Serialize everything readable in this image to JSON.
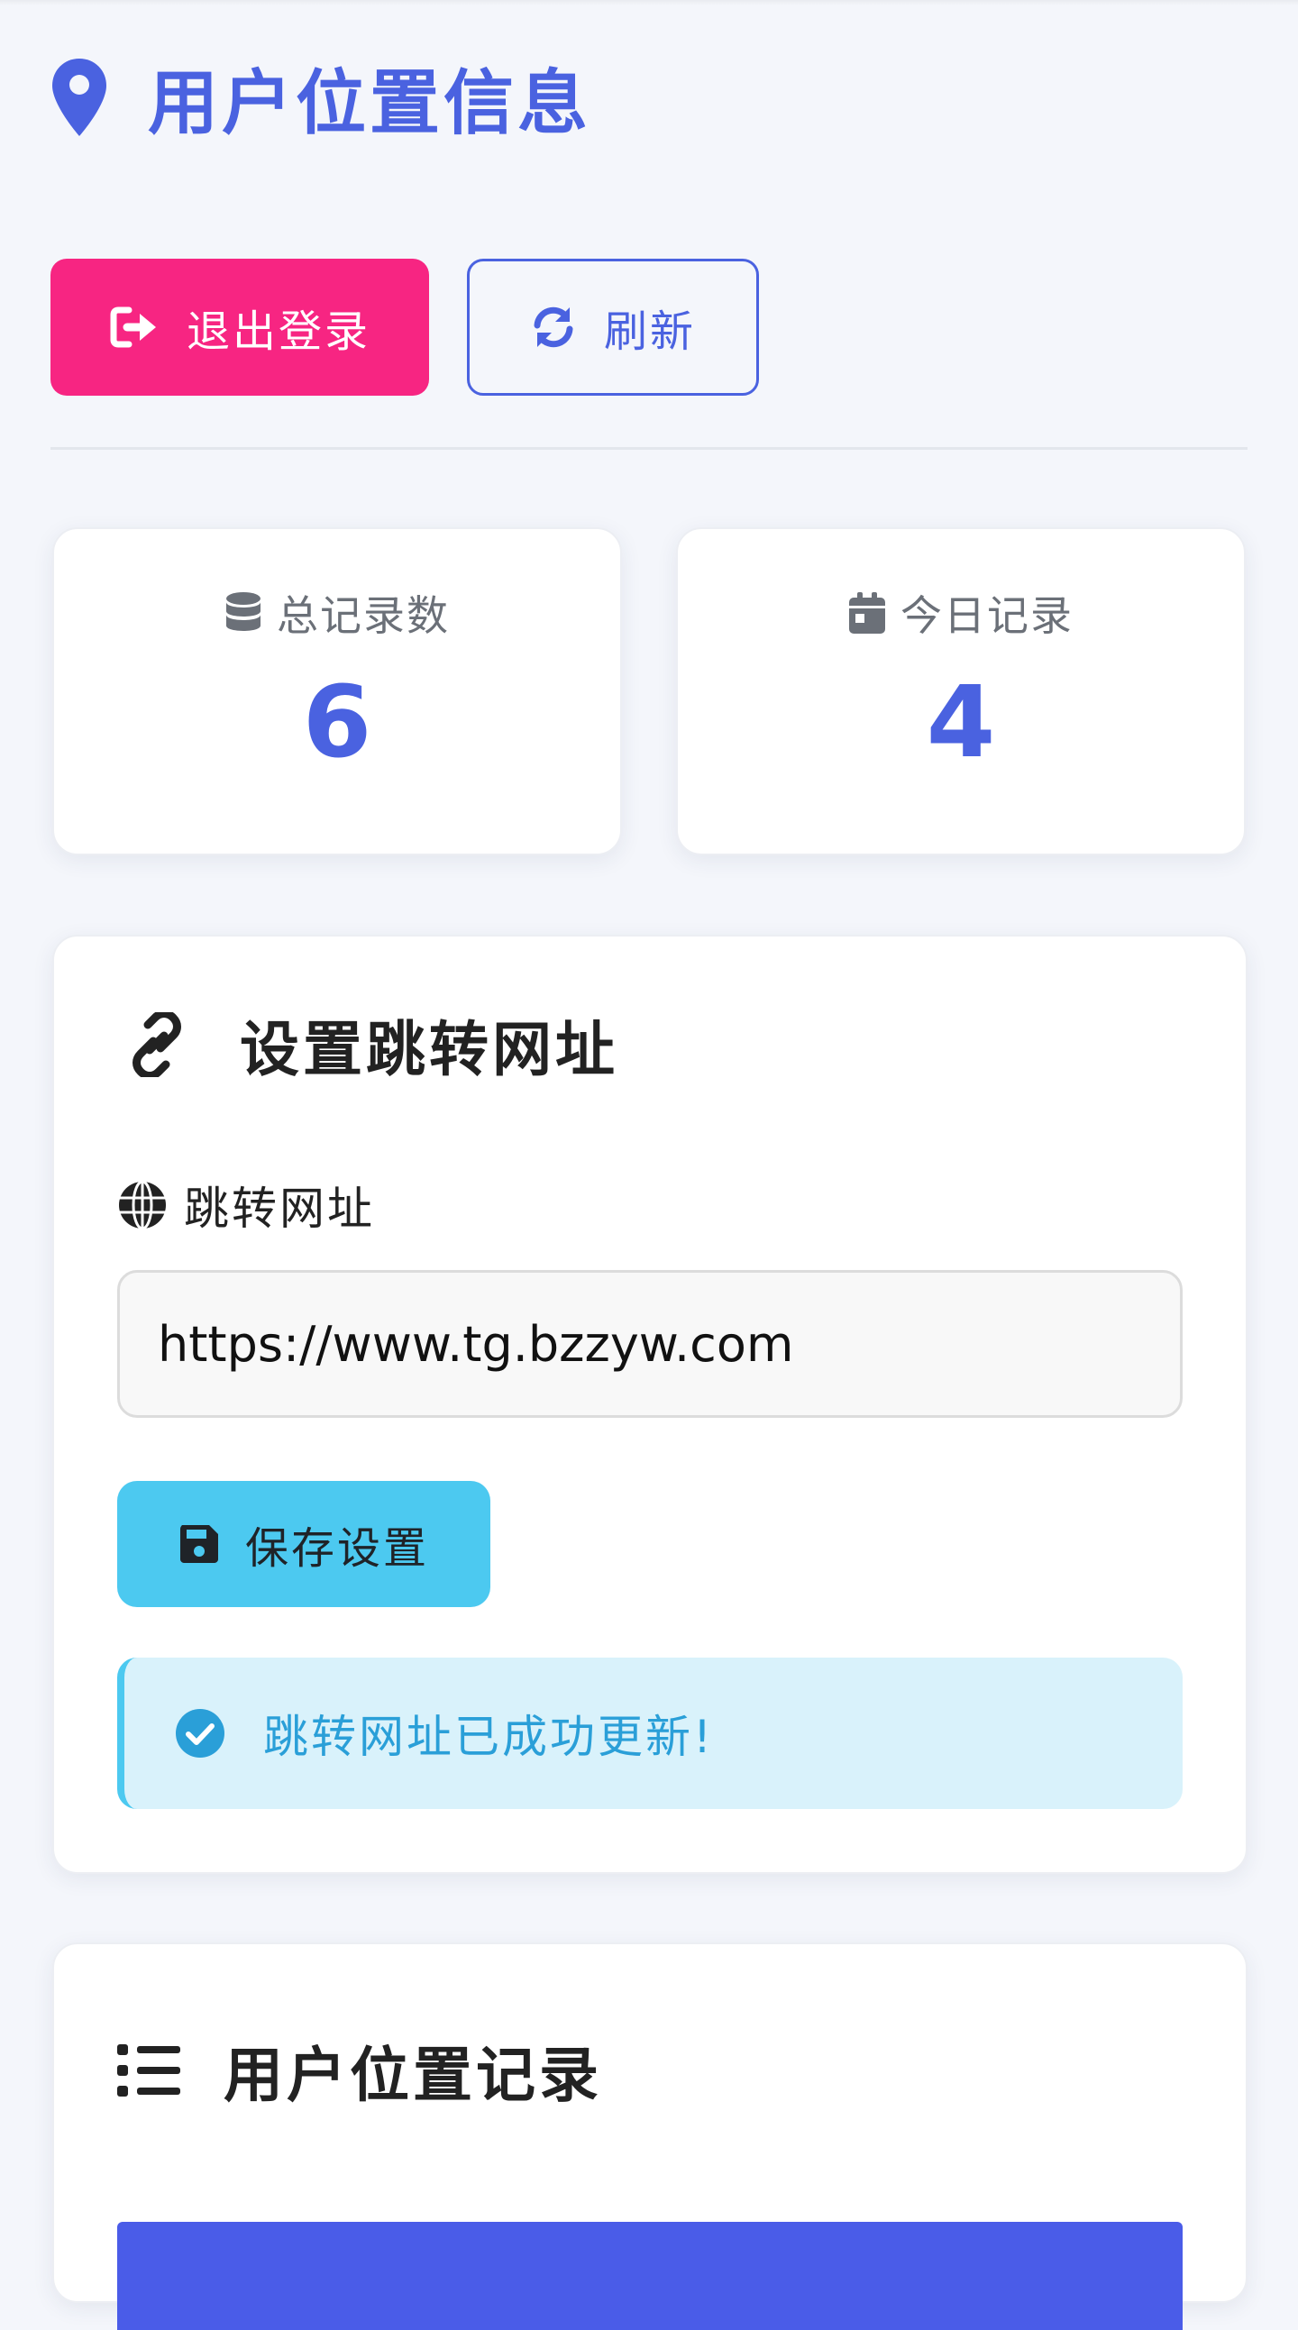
{
  "header": {
    "title": "用户位置信息",
    "icon": "map-pin-icon"
  },
  "actions": {
    "logout_label": "退出登录",
    "refresh_label": "刷新"
  },
  "stats": {
    "total": {
      "label": "总记录数",
      "value": "6",
      "icon": "database-icon"
    },
    "today": {
      "label": "今日记录",
      "value": "4",
      "icon": "calendar-icon"
    }
  },
  "settings": {
    "title": "设置跳转网址",
    "field_label": "跳转网址",
    "url_value": "https://www.tg.bzzyw.com",
    "save_label": "保存设置",
    "alert_text": "跳转网址已成功更新!"
  },
  "records": {
    "title": "用户位置记录"
  },
  "colors": {
    "accent": "#4a62e0",
    "danger": "#f72582",
    "info": "#4cc9f0",
    "info_bg": "#d9f2fb",
    "background": "#f4f6fb"
  }
}
